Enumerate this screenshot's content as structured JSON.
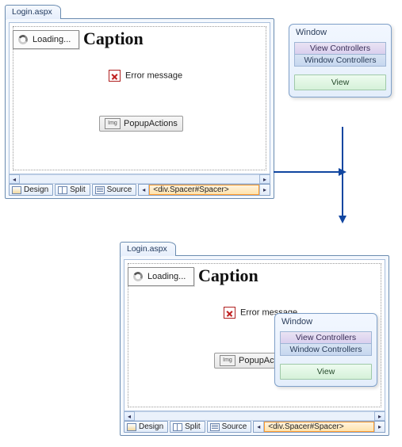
{
  "designer": {
    "tab_title": "Login.aspx",
    "loading_text": "Loading...",
    "caption": "Caption",
    "error_label": "Error message",
    "popup_label": "PopupActions",
    "img_chip": "Img",
    "modes": {
      "design": "Design",
      "split": "Split",
      "source": "Source"
    },
    "breadcrumb": "<div.Spacer#Spacer>"
  },
  "palette": {
    "title": "Window",
    "row_view": "View Controllers",
    "row_win": "Window Controllers",
    "btn": "View"
  }
}
